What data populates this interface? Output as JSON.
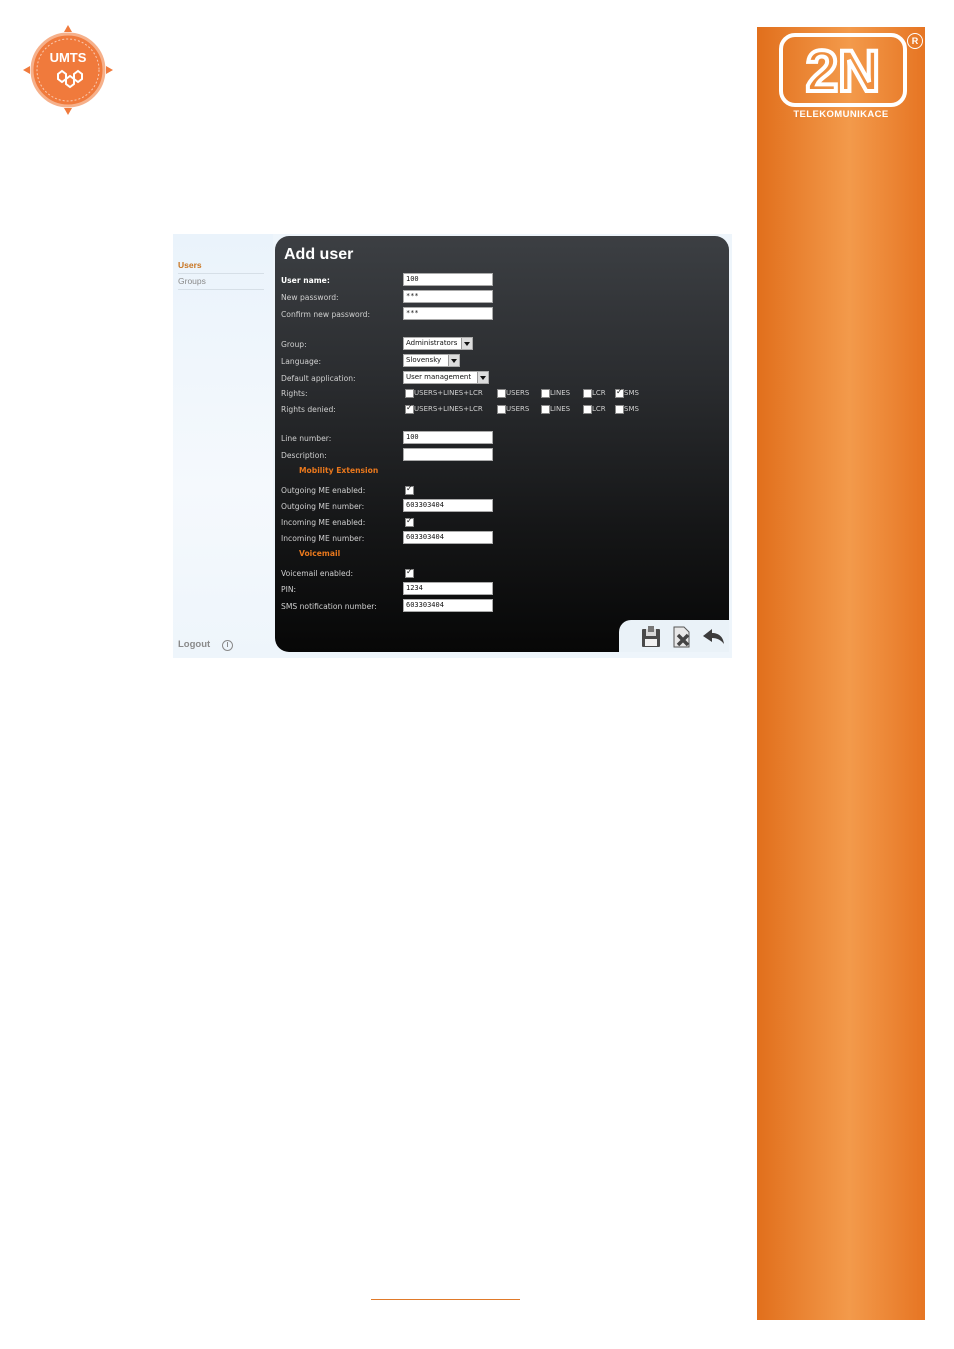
{
  "umts_logo": {
    "text": "UMTS"
  },
  "brand": {
    "logo_text": "2N",
    "tagline": "TELEKOMUNIKACE",
    "registered": "R"
  },
  "sidebar": {
    "items": [
      {
        "label": "Users",
        "active": true
      },
      {
        "label": "Groups",
        "active": false
      }
    ],
    "logout": "Logout"
  },
  "form": {
    "title": "Add user",
    "user_name": {
      "label": "User name:",
      "value": "100"
    },
    "new_password": {
      "label": "New password:",
      "value": "***"
    },
    "confirm_password": {
      "label": "Confirm new password:",
      "value": "***"
    },
    "group": {
      "label": "Group:",
      "value": "Administrators"
    },
    "language": {
      "label": "Language:",
      "value": "Slovensky"
    },
    "default_application": {
      "label": "Default application:",
      "value": "User management"
    },
    "rights": {
      "label": "Rights:",
      "options": [
        {
          "label": "USERS+LINES+LCR",
          "checked": false
        },
        {
          "label": "USERS",
          "checked": false
        },
        {
          "label": "LINES",
          "checked": false
        },
        {
          "label": "LCR",
          "checked": false
        },
        {
          "label": "SMS",
          "checked": true
        }
      ]
    },
    "rights_denied": {
      "label": "Rights denied:",
      "options": [
        {
          "label": "USERS+LINES+LCR",
          "checked": true
        },
        {
          "label": "USERS",
          "checked": false
        },
        {
          "label": "LINES",
          "checked": false
        },
        {
          "label": "LCR",
          "checked": false
        },
        {
          "label": "SMS",
          "checked": false
        }
      ]
    },
    "line_number": {
      "label": "Line number:",
      "value": "100"
    },
    "description": {
      "label": "Description:",
      "value": ""
    },
    "mobility_section": "Mobility Extension",
    "outgoing_me_enabled": {
      "label": "Outgoing ME enabled:",
      "checked": true
    },
    "outgoing_me_number": {
      "label": "Outgoing ME number:",
      "value": "603303404"
    },
    "incoming_me_enabled": {
      "label": "Incoming ME enabled:",
      "checked": true
    },
    "incoming_me_number": {
      "label": "Incoming ME number:",
      "value": "603303404"
    },
    "voicemail_section": "Voicemail",
    "voicemail_enabled": {
      "label": "Voicemail enabled:",
      "checked": true
    },
    "pin": {
      "label": "PIN:",
      "value": "1234"
    },
    "sms_notification_number": {
      "label": "SMS notification number:",
      "value": "603303404"
    }
  },
  "toolbar": {
    "icons": [
      "save-icon",
      "delete-icon",
      "back-arrow-icon"
    ]
  },
  "colors": {
    "accent_orange": "#e9781d",
    "band_orange": "#f39a4b",
    "panel_dark": "#1a1b1c",
    "sidebar_bg": "#eef5fb"
  }
}
